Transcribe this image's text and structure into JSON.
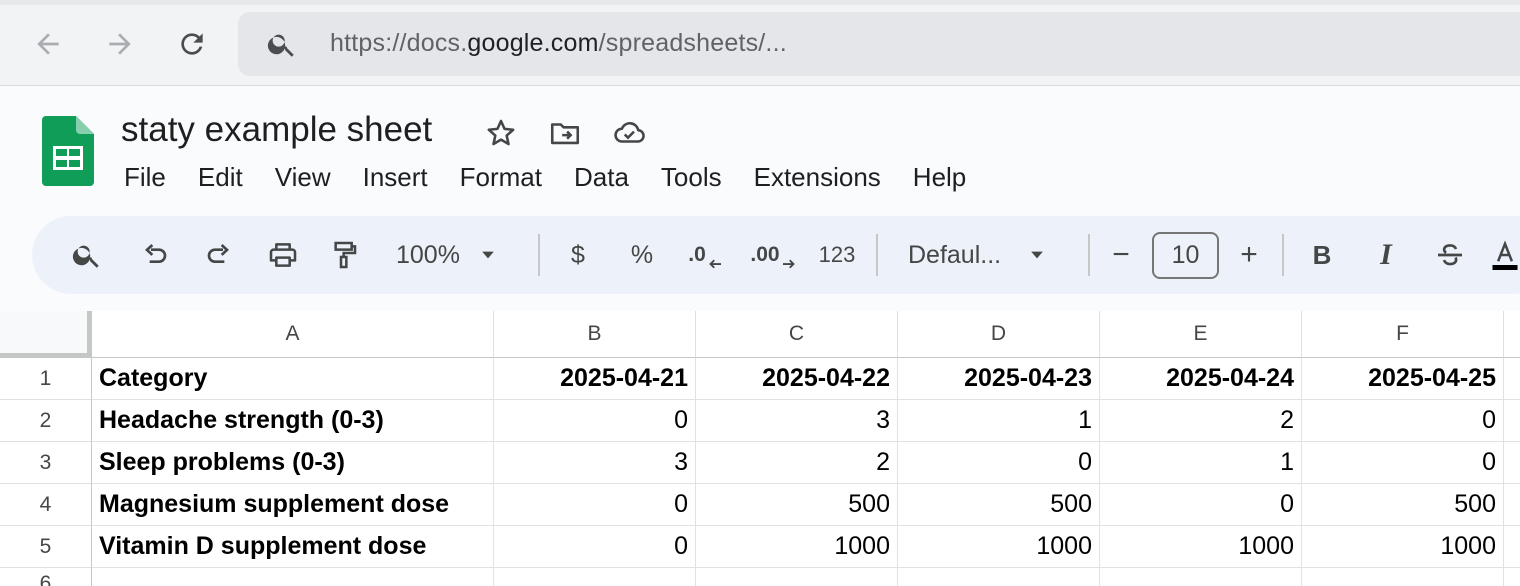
{
  "browser": {
    "url_prefix": "https://docs.",
    "url_host": "google.com",
    "url_path": "/spreadsheets/..."
  },
  "app": {
    "title": "staty example sheet",
    "menu": [
      "File",
      "Edit",
      "View",
      "Insert",
      "Format",
      "Data",
      "Tools",
      "Extensions",
      "Help"
    ]
  },
  "toolbar": {
    "zoom": "100%",
    "currency": "$",
    "percent": "%",
    "decrease_decimal": ".0",
    "increase_decimal": ".00",
    "number_format": "123",
    "font": "Defaul...",
    "font_size": "10",
    "minus": "−",
    "plus": "+",
    "bold": "B",
    "italic": "I"
  },
  "sheet": {
    "columns": [
      "A",
      "B",
      "C",
      "D",
      "E",
      "F"
    ],
    "rows": [
      "1",
      "2",
      "3",
      "4",
      "5",
      "6"
    ],
    "cells": [
      [
        "Category",
        "2025-04-21",
        "2025-04-22",
        "2025-04-23",
        "2025-04-24",
        "2025-04-25"
      ],
      [
        "Headache strength (0-3)",
        "0",
        "3",
        "1",
        "2",
        "0"
      ],
      [
        "Sleep problems (0-3)",
        "3",
        "2",
        "0",
        "1",
        "0"
      ],
      [
        "Magnesium supplement dose",
        "0",
        "500",
        "500",
        "0",
        "500"
      ],
      [
        "Vitamin D supplement dose",
        "0",
        "1000",
        "1000",
        "1000",
        "1000"
      ],
      [
        "",
        "",
        "",
        "",
        "",
        ""
      ]
    ]
  },
  "colors": {
    "sheets_green": "#0f9d58",
    "toolbar_bg": "#edf2fa",
    "header_bg": "#f9fbfd"
  },
  "icons": [
    "back-arrow-icon",
    "forward-arrow-icon",
    "reload-icon",
    "search-icon",
    "sheets-logo-icon",
    "star-icon",
    "move-folder-icon",
    "cloud-saved-icon",
    "undo-icon",
    "redo-icon",
    "print-icon",
    "paint-format-icon",
    "dropdown-caret-icon",
    "strikethrough-icon",
    "text-color-icon"
  ]
}
